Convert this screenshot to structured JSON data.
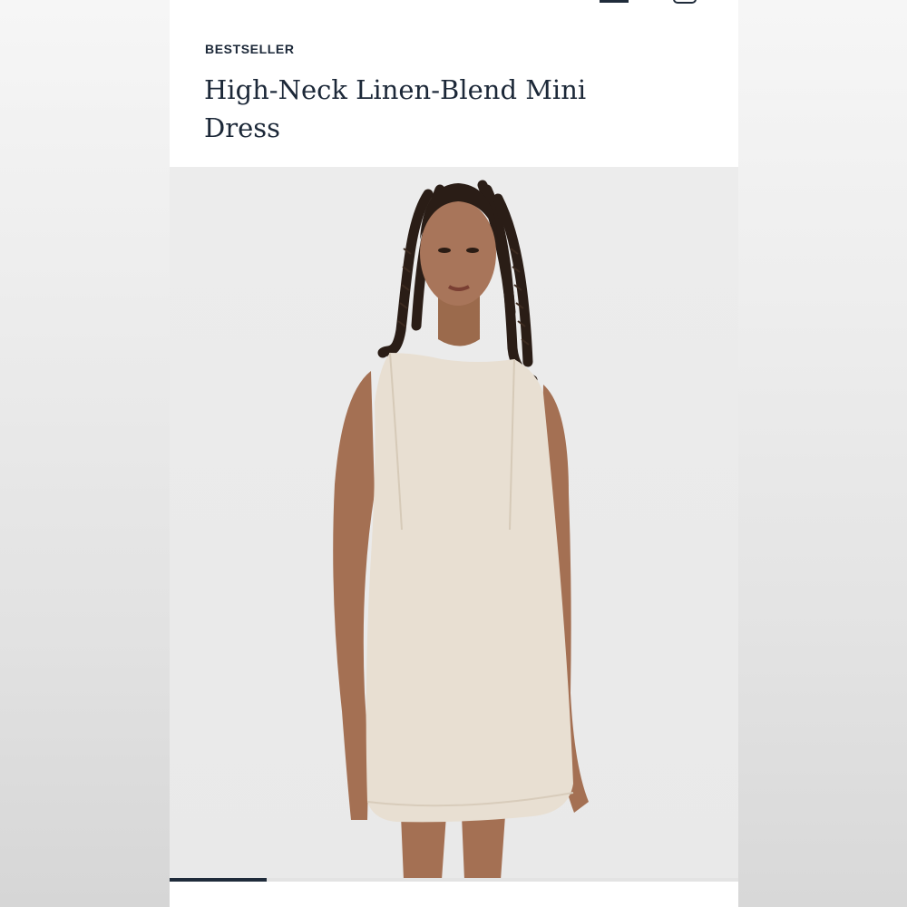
{
  "product": {
    "badge": "BESTSELLER",
    "title": "High-Neck Linen-Blend Mini Dress"
  },
  "header": {
    "icons": [
      "account-icon",
      "bag-icon"
    ]
  },
  "gallery": {
    "current_slide": 1,
    "progress": 0.17
  },
  "colors": {
    "text": "#1c2838",
    "indicator": "#1f2b3a",
    "dress": "#e8dfd2",
    "photo_bg": "#ebebeb"
  }
}
